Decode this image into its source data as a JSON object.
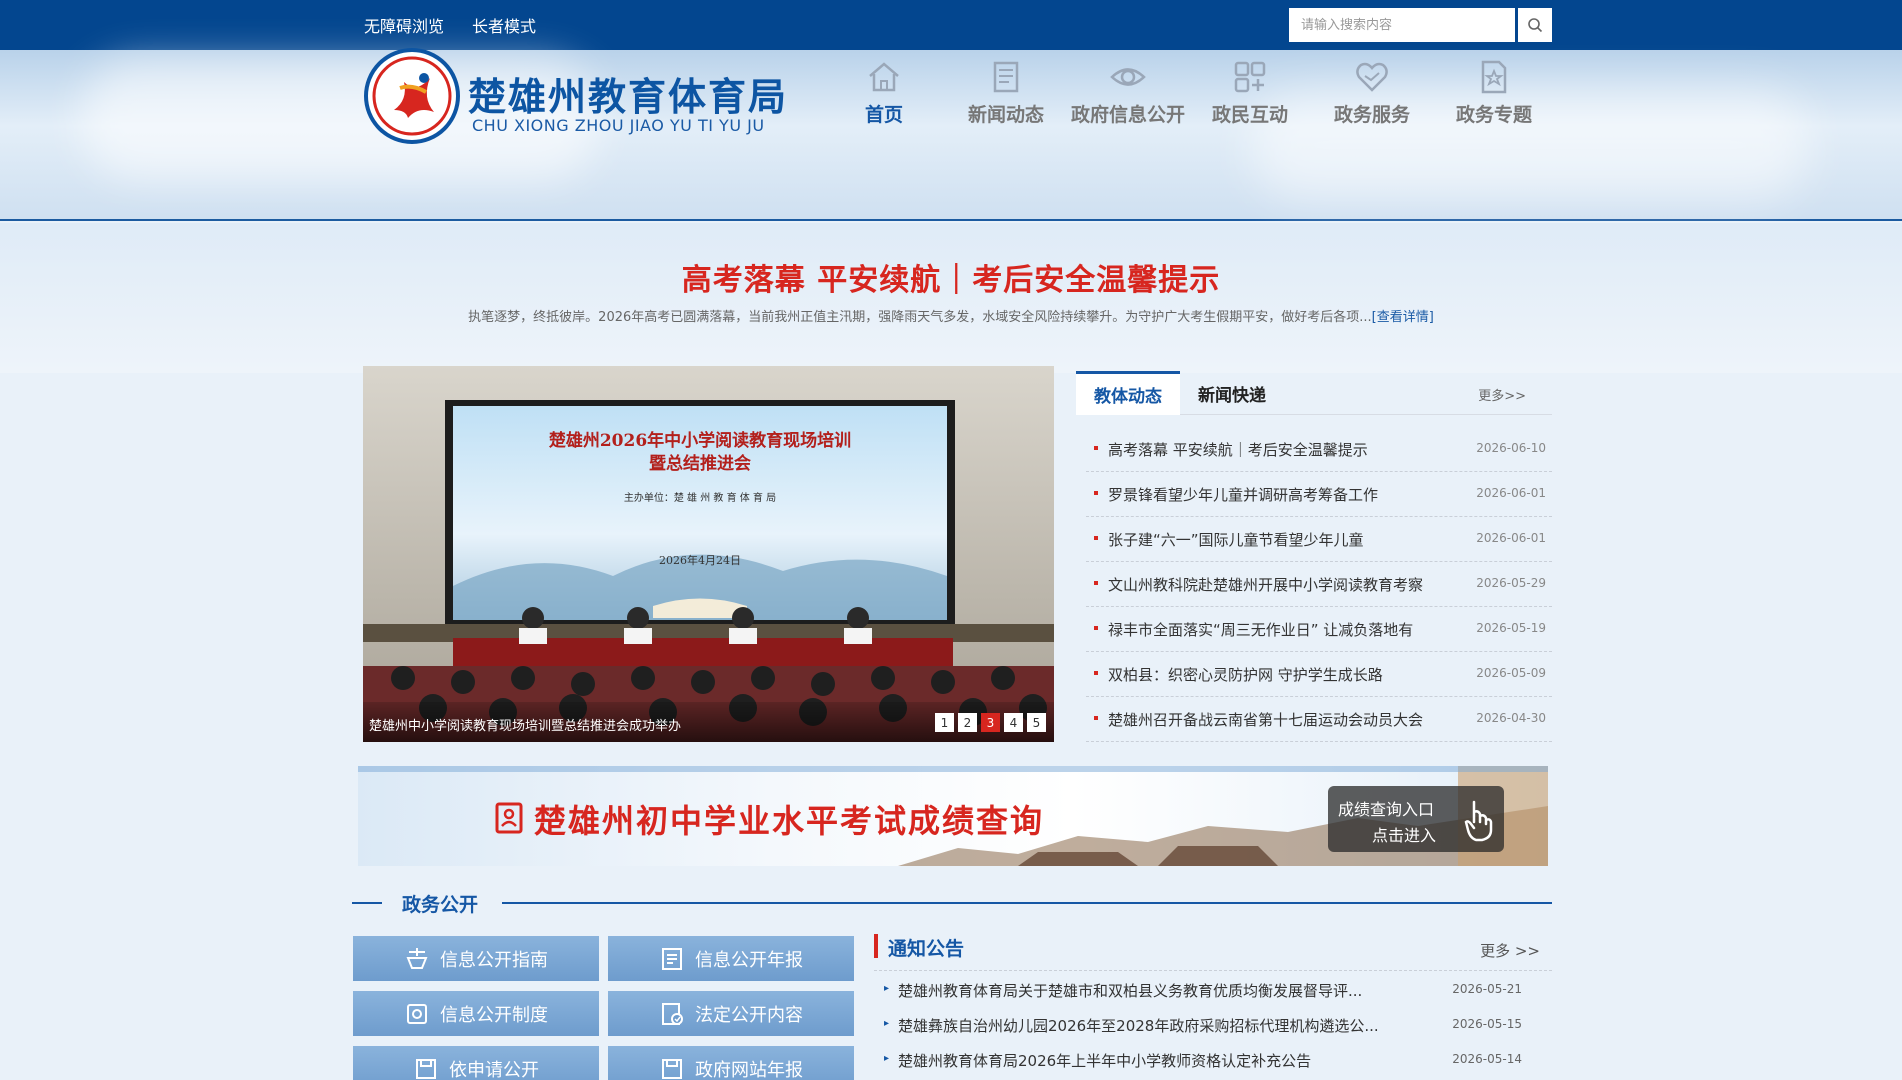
{
  "topbar": {
    "links": [
      "无障碍浏览",
      "长者模式"
    ],
    "search_placeholder": "请输入搜索内容"
  },
  "brand": {
    "name_cn": "楚雄州教育体育局",
    "name_en": "CHU XIONG ZHOU JIAO YU TI YU JU"
  },
  "nav": [
    {
      "label": "首页",
      "icon": "home-icon"
    },
    {
      "label": "新闻动态",
      "icon": "news-icon"
    },
    {
      "label": "政府信息公开",
      "icon": "eye-icon"
    },
    {
      "label": "政民互动",
      "icon": "interaction-icon"
    },
    {
      "label": "政务服务",
      "icon": "handshake-icon"
    },
    {
      "label": "政务专题",
      "icon": "star-doc-icon"
    }
  ],
  "headline": {
    "title": "高考落幕 平安续航｜考后安全温馨提示",
    "summary": "执笔逐梦，终抵彼岸。2026年高考已圆满落幕，当前我州正值主汛期，强降雨天气多发，水域安全风险持续攀升。为守护广大考生假期平安，做好考后各项...",
    "more": "[查看详情]"
  },
  "slider": {
    "caption": "楚雄州中小学阅读教育现场培训暨总结推进会成功举办",
    "pages": [
      "1",
      "2",
      "3",
      "4",
      "5"
    ],
    "active_page": 3,
    "screen_title_1": "楚雄州2026年中小学阅读教育现场培训",
    "screen_title_2": "暨总结推进会",
    "screen_org": "主办单位：楚 雄 州 教 育 体 育 局",
    "screen_date": "2026年4月24日"
  },
  "news": {
    "tabs": [
      "教体动态",
      "新闻快递"
    ],
    "more": "更多>>",
    "items": [
      {
        "title": "高考落幕 平安续航｜考后安全温馨提示",
        "date": "2026-06-10"
      },
      {
        "title": "罗景锋看望少年儿童并调研高考筹备工作",
        "date": "2026-06-01"
      },
      {
        "title": "张子建“六一”国际儿童节看望少年儿童",
        "date": "2026-06-01"
      },
      {
        "title": "文山州教科院赴楚雄州开展中小学阅读教育考察",
        "date": "2026-05-29"
      },
      {
        "title": "禄丰市全面落实“周三无作业日” 让减负落地有",
        "date": "2026-05-19"
      },
      {
        "title": "双柏县：织密心灵防护网 守护学生成长路",
        "date": "2026-05-09"
      },
      {
        "title": "楚雄州召开备战云南省第十七届运动会动员大会",
        "date": "2026-04-30"
      }
    ]
  },
  "ad": {
    "title": "楚雄州初中学业水平考试成绩查询",
    "entry_line1": "成绩查询入口",
    "entry_line2": "点击进入"
  },
  "section": {
    "title": "政务公开"
  },
  "gov_buttons": [
    {
      "label": "信息公开指南",
      "icon": "guide-icon"
    },
    {
      "label": "信息公开年报",
      "icon": "report-icon"
    },
    {
      "label": "信息公开制度",
      "icon": "system-icon"
    },
    {
      "label": "法定公开内容",
      "icon": "legal-icon"
    },
    {
      "label": "依申请公开",
      "icon": "apply-icon"
    },
    {
      "label": "政府网站年报",
      "icon": "website-report-icon"
    }
  ],
  "notice": {
    "title": "通知公告",
    "more": "更多 >>",
    "items": [
      {
        "title": "楚雄州教育体育局关于楚雄市和双柏县义务教育优质均衡发展督导评...",
        "date": "2026-05-21"
      },
      {
        "title": "楚雄彝族自治州幼儿园2026年至2028年政府采购招标代理机构遴选公...",
        "date": "2026-05-15"
      },
      {
        "title": "楚雄州教育体育局2026年上半年中小学教师资格认定补充公告",
        "date": "2026-05-14"
      }
    ]
  },
  "colors": {
    "primary": "#03468f",
    "accent": "#d7261f",
    "nav_active": "#1557a5"
  }
}
